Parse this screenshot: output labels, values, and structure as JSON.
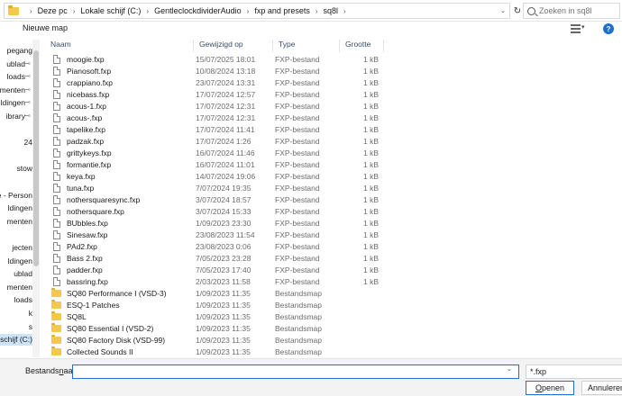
{
  "address": {
    "crumbs": [
      "Deze pc",
      "Lokale schijf (C:)",
      "GentleclockdividerAudio",
      "fxp and presets",
      "sq8l"
    ],
    "separator": "›",
    "dropdown": "⌄",
    "refresh": "↻"
  },
  "search": {
    "placeholder": "Zoeken in sq8l"
  },
  "toolbar": {
    "new_folder": "Nieuwe map",
    "view_dropdown": "▾",
    "help": "?"
  },
  "nav": {
    "items": [
      {
        "label": "pegang",
        "pinned": false
      },
      {
        "label": "ublad",
        "pinned": true
      },
      {
        "label": "loads",
        "pinned": true
      },
      {
        "label": "menten",
        "pinned": true
      },
      {
        "label": "ldingen",
        "pinned": true
      },
      {
        "label": "ibrary",
        "pinned": true
      },
      {
        "label": "",
        "pinned": false
      },
      {
        "label": "24",
        "pinned": false
      },
      {
        "label": "",
        "pinned": false
      },
      {
        "label": "stow",
        "pinned": false
      },
      {
        "label": "",
        "pinned": false
      },
      {
        "label": "ve - Person",
        "pinned": false
      },
      {
        "label": "ldingen",
        "pinned": false
      },
      {
        "label": "menten",
        "pinned": false
      },
      {
        "label": "",
        "pinned": false
      },
      {
        "label": "jecten",
        "pinned": false
      },
      {
        "label": "ldingen",
        "pinned": false
      },
      {
        "label": "ublad",
        "pinned": false
      },
      {
        "label": "menten",
        "pinned": false
      },
      {
        "label": "loads",
        "pinned": false
      },
      {
        "label": "k",
        "pinned": false
      },
      {
        "label": "s",
        "pinned": false
      },
      {
        "label": "e schijf (C:)",
        "pinned": false,
        "selected": true
      }
    ],
    "pin_glyph": "📌"
  },
  "columns": {
    "name": "Naam",
    "date": "Gewijzigd op",
    "type": "Type",
    "size": "Grootte",
    "sort_glyph": "^"
  },
  "files": [
    {
      "name": "moogie.fxp",
      "date": "15/07/2025 18:01",
      "type": "FXP-bestand",
      "size": "1 kB",
      "kind": "file"
    },
    {
      "name": "Pianosoft.fxp",
      "date": "10/08/2024 13:18",
      "type": "FXP-bestand",
      "size": "1 kB",
      "kind": "file"
    },
    {
      "name": "crappiano.fxp",
      "date": "23/07/2024 13:31",
      "type": "FXP-bestand",
      "size": "1 kB",
      "kind": "file"
    },
    {
      "name": "nicebass.fxp",
      "date": "17/07/2024 12:57",
      "type": "FXP-bestand",
      "size": "1 kB",
      "kind": "file"
    },
    {
      "name": "acous-1.fxp",
      "date": "17/07/2024 12:31",
      "type": "FXP-bestand",
      "size": "1 kB",
      "kind": "file"
    },
    {
      "name": "acous-.fxp",
      "date": "17/07/2024 12:31",
      "type": "FXP-bestand",
      "size": "1 kB",
      "kind": "file"
    },
    {
      "name": "tapelike.fxp",
      "date": "17/07/2024 11:41",
      "type": "FXP-bestand",
      "size": "1 kB",
      "kind": "file"
    },
    {
      "name": "padzak.fxp",
      "date": "17/07/2024 1:26",
      "type": "FXP-bestand",
      "size": "1 kB",
      "kind": "file"
    },
    {
      "name": "grittykeys.fxp",
      "date": "16/07/2024 11:46",
      "type": "FXP-bestand",
      "size": "1 kB",
      "kind": "file"
    },
    {
      "name": "formantie.fxp",
      "date": "16/07/2024 11:01",
      "type": "FXP-bestand",
      "size": "1 kB",
      "kind": "file"
    },
    {
      "name": "keya.fxp",
      "date": "14/07/2024 19:06",
      "type": "FXP-bestand",
      "size": "1 kB",
      "kind": "file"
    },
    {
      "name": "tuna.fxp",
      "date": "7/07/2024 19:35",
      "type": "FXP-bestand",
      "size": "1 kB",
      "kind": "file"
    },
    {
      "name": "nothersquaresync.fxp",
      "date": "3/07/2024 18:57",
      "type": "FXP-bestand",
      "size": "1 kB",
      "kind": "file"
    },
    {
      "name": "nothersquare.fxp",
      "date": "3/07/2024 15:33",
      "type": "FXP-bestand",
      "size": "1 kB",
      "kind": "file"
    },
    {
      "name": "BUbbles.fxp",
      "date": "1/09/2023 23:30",
      "type": "FXP-bestand",
      "size": "1 kB",
      "kind": "file"
    },
    {
      "name": "Sinesaw.fxp",
      "date": "23/08/2023 11:54",
      "type": "FXP-bestand",
      "size": "1 kB",
      "kind": "file"
    },
    {
      "name": "PAd2.fxp",
      "date": "23/08/2023 0:06",
      "type": "FXP-bestand",
      "size": "1 kB",
      "kind": "file"
    },
    {
      "name": "Bass 2.fxp",
      "date": "7/05/2023 23:28",
      "type": "FXP-bestand",
      "size": "1 kB",
      "kind": "file"
    },
    {
      "name": "padder.fxp",
      "date": "7/05/2023 17:40",
      "type": "FXP-bestand",
      "size": "1 kB",
      "kind": "file"
    },
    {
      "name": "bassring.fxp",
      "date": "2/03/2023 11:58",
      "type": "FXP-bestand",
      "size": "1 kB",
      "kind": "file"
    },
    {
      "name": "SQ80 Performance I (VSD-3)",
      "date": "1/09/2023 11:35",
      "type": "Bestandsmap",
      "size": "",
      "kind": "folder"
    },
    {
      "name": "ESQ-1 Patches",
      "date": "1/09/2023 11:35",
      "type": "Bestandsmap",
      "size": "",
      "kind": "folder"
    },
    {
      "name": "SQ8L",
      "date": "1/09/2023 11:35",
      "type": "Bestandsmap",
      "size": "",
      "kind": "folder"
    },
    {
      "name": "SQ80 Essential I (VSD-2)",
      "date": "1/09/2023 11:35",
      "type": "Bestandsmap",
      "size": "",
      "kind": "folder"
    },
    {
      "name": "SQ80 Factory Disk (VSD-99)",
      "date": "1/09/2023 11:35",
      "type": "Bestandsmap",
      "size": "",
      "kind": "folder"
    },
    {
      "name": "Collected Sounds II",
      "date": "1/09/2023 11:35",
      "type": "Bestandsmap",
      "size": "",
      "kind": "folder"
    }
  ],
  "bottom": {
    "filename_label_pre": "Bestands",
    "filename_label_u": "n",
    "filename_label_post": "aam:",
    "filename_value": "",
    "filename_dropdown": "⌄",
    "filter": "*.fxp",
    "open_pre": "",
    "open_u": "O",
    "open_post": "penen",
    "cancel": "Annuleren"
  }
}
